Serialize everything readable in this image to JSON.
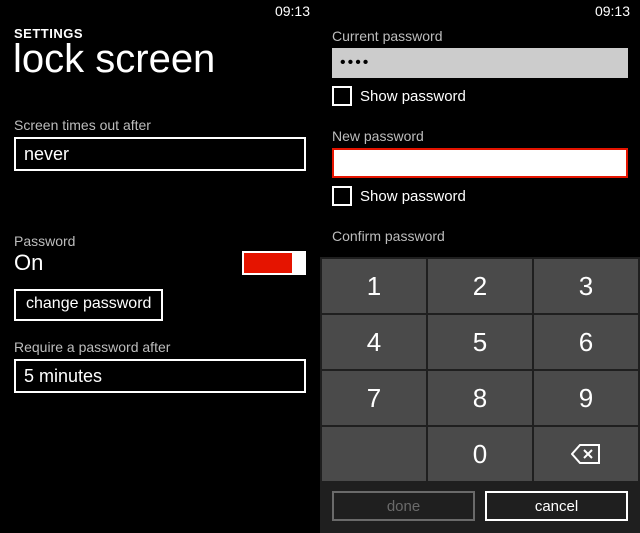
{
  "status": {
    "time": "09:13"
  },
  "left": {
    "header_small": "SETTINGS",
    "header_big": "lock screen",
    "timeout_label": "Screen times out after",
    "timeout_value": "never",
    "password_label": "Password",
    "password_state": "On",
    "change_password": "change password",
    "require_label": "Require a password after",
    "require_value": "5 minutes"
  },
  "right": {
    "current_label": "Current password",
    "current_value": "••••",
    "show_password": "Show password",
    "new_label": "New password",
    "new_value": "",
    "confirm_label": "Confirm password",
    "done": "done",
    "cancel": "cancel"
  },
  "keypad": {
    "k1": "1",
    "k2": "2",
    "k3": "3",
    "k4": "4",
    "k5": "5",
    "k6": "6",
    "k7": "7",
    "k8": "8",
    "k9": "9",
    "k0": "0"
  }
}
